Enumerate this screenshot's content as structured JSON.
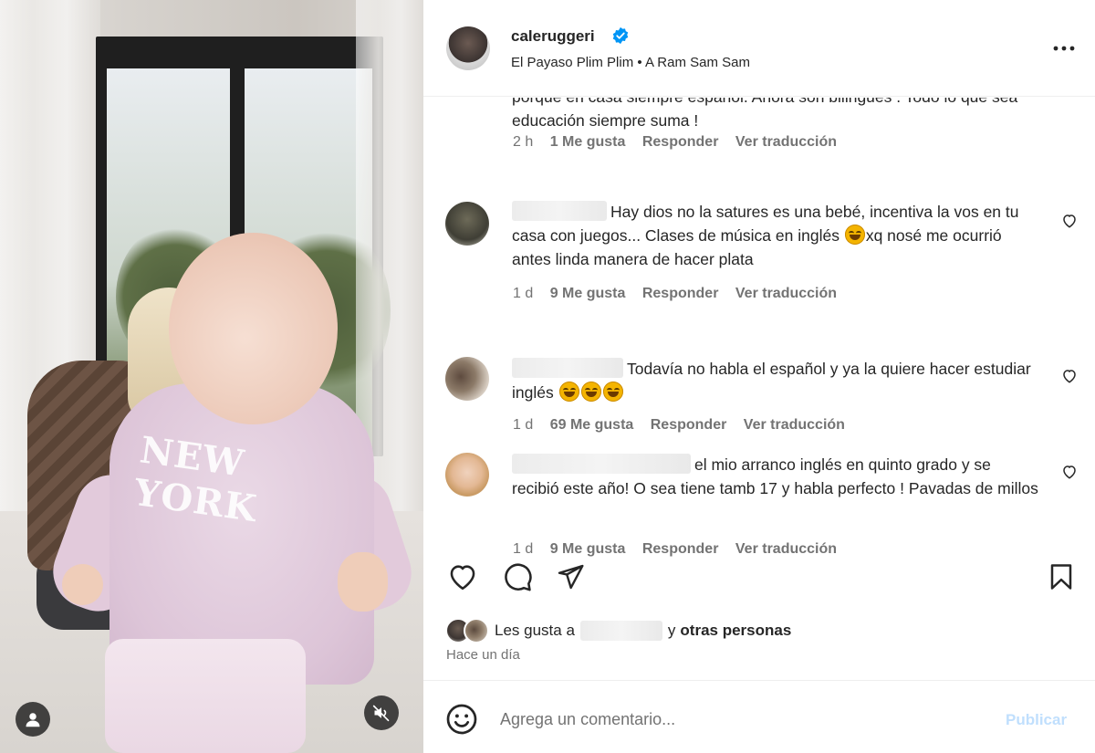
{
  "post": {
    "username": "caleruggeri",
    "verified": true,
    "audio": "El Payaso Plim Plim • A Ram Sam Sam",
    "more_icon": "more-horizontal-icon"
  },
  "comments": [
    {
      "text": "porque en casa siempre español. Ahora son bilingues . Todo lo que sea educación siempre suma !",
      "time": "2 h",
      "likes": "1 Me gusta",
      "reply": "Responder",
      "translate": "Ver traducción"
    },
    {
      "text": "Hay dios no la satures es una bebé, incentiva la vos en tu casa con juegos... Clases de música en inglés",
      "text_after_emoji": "xq nosé me ocurrió antes linda manera de hacer plata",
      "time": "1 d",
      "likes": "9 Me gusta",
      "reply": "Responder",
      "translate": "Ver traducción"
    },
    {
      "text": "Todavía no habla el español y ya la quiere hacer estudiar inglés",
      "time": "1 d",
      "likes": "69 Me gusta",
      "reply": "Responder",
      "translate": "Ver traducción"
    },
    {
      "text": "el mio arranco inglés en quinto grado y se recibió este año! O sea tiene tamb 17 y habla perfecto ! Pavadas de millos",
      "time": "1 d",
      "likes": "9 Me gusta",
      "reply": "Responder",
      "translate": "Ver traducción"
    }
  ],
  "actions": {
    "like_icon": "heart-icon",
    "comment_icon": "comment-icon",
    "share_icon": "send-icon",
    "save_icon": "bookmark-icon"
  },
  "likes_summary": {
    "prefix": "Les gusta a",
    "suffix_connector": "y",
    "suffix": "otras personas"
  },
  "time_ago": "Hace un día",
  "add_comment": {
    "placeholder": "Agrega un comentario...",
    "publish": "Publicar"
  },
  "media": {
    "print_text": "NEW YORK"
  },
  "colors": {
    "verified_blue": "#0095f6",
    "publish_disabled": "#c0dffd",
    "secondary_text": "#737373"
  }
}
